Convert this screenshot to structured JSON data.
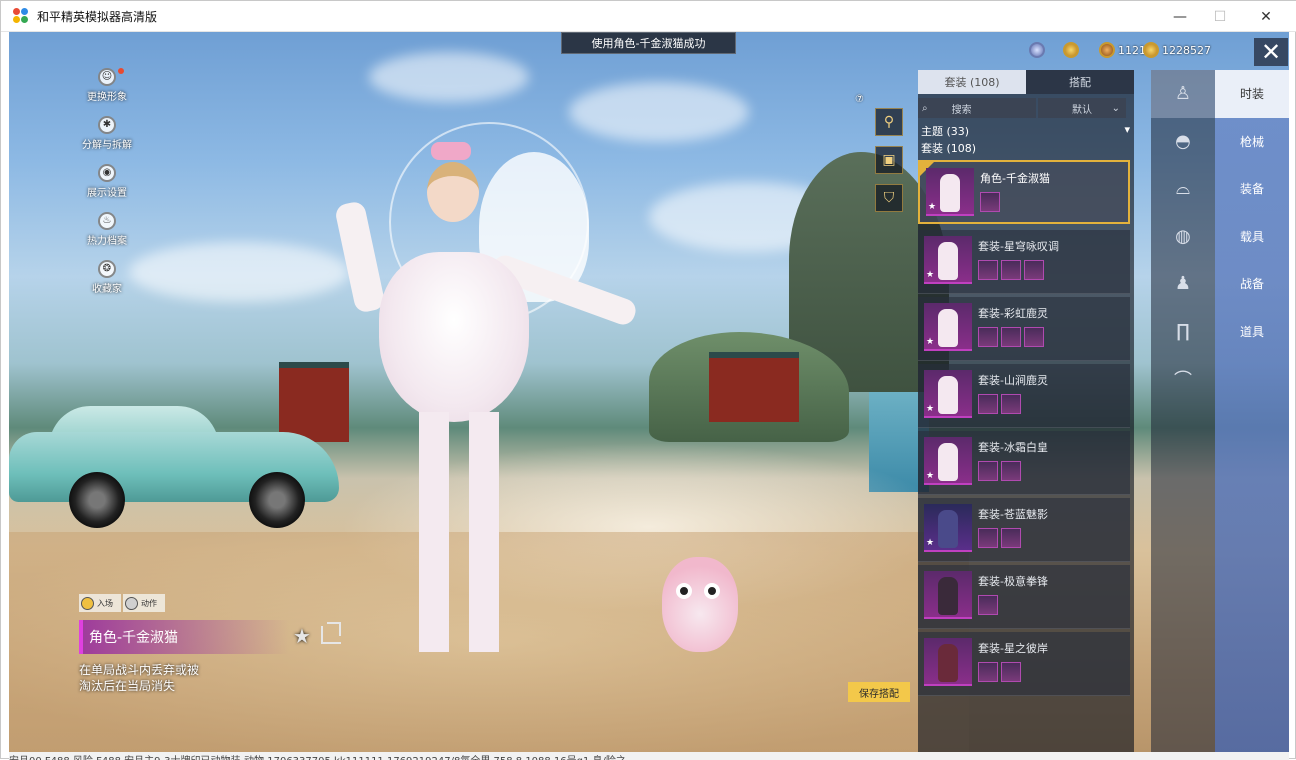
{
  "window": {
    "title": "和平精英模拟器高清版",
    "minimize": "—",
    "maximize": "☐",
    "close": "✕"
  },
  "toast": "使用角色-千金淑猫成功",
  "left_menu": [
    {
      "label": "更换形象",
      "icon": "person-icon",
      "glyph": "☺"
    },
    {
      "label": "分解与拆解",
      "icon": "gear-icon",
      "glyph": "✱"
    },
    {
      "label": "展示设置",
      "icon": "eye-icon",
      "glyph": "◉"
    },
    {
      "label": "热力档案",
      "icon": "flame-icon",
      "glyph": "♨"
    },
    {
      "label": "收藏家",
      "icon": "badge-icon",
      "glyph": "❂"
    }
  ],
  "currency": [
    {
      "icon": "gem-icon",
      "value": ""
    },
    {
      "icon": "coin-icon",
      "value": ""
    },
    {
      "icon": "token-icon",
      "value": "1121"
    },
    {
      "icon": "gold-coin-icon",
      "value": "1228527"
    }
  ],
  "help_label": "⑦",
  "bottom": {
    "entry_tab": "入场",
    "action_tab": "动作",
    "item_name": "角色-千金淑猫",
    "description": [
      "在单局战斗内丢弃或被",
      "淘汰后在当局消失"
    ],
    "save_button": "保存搭配"
  },
  "panel": {
    "tabs": [
      "套装 (108)",
      "搭配"
    ],
    "search_placeholder": "搜索",
    "sort": "默认",
    "theme": "主题 (33)",
    "subheader": "套装 (108)",
    "items": [
      {
        "name": "角色-千金淑猫",
        "parts": 1
      },
      {
        "name": "套装-星穹咏叹调",
        "parts": 3
      },
      {
        "name": "套装-彩虹鹿灵",
        "parts": 3
      },
      {
        "name": "套装-山涧鹿灵",
        "parts": 2
      },
      {
        "name": "套装-冰霜白皇",
        "parts": 2
      },
      {
        "name": "套装-苍蓝魅影",
        "parts": 2
      },
      {
        "name": "套装-极意拳锋",
        "parts": 1
      },
      {
        "name": "套装-星之彼岸",
        "parts": 2
      }
    ]
  },
  "categories": [
    {
      "label": "时装",
      "icon": "figure-icon",
      "glyph": "♙"
    },
    {
      "label": "枪械",
      "icon": "cap-icon",
      "glyph": "◓"
    },
    {
      "label": "装备",
      "icon": "glasses-icon",
      "glyph": "⌓"
    },
    {
      "label": "载具",
      "icon": "mask-icon",
      "glyph": "◍"
    },
    {
      "label": "战备",
      "icon": "outfit-icon",
      "glyph": "♟"
    },
    {
      "label": "道具",
      "icon": "pants-icon",
      "glyph": "∏"
    },
    {
      "label": "",
      "icon": "shoes-icon",
      "glyph": "⌒"
    }
  ],
  "under_window_text": "安旦00    F488    风险    F488 安旦主9-3士牌印已动物装-动物    1706337705    kk111111    1769219247/8氧全里    758.8    1088    16号g1    息/险之"
}
